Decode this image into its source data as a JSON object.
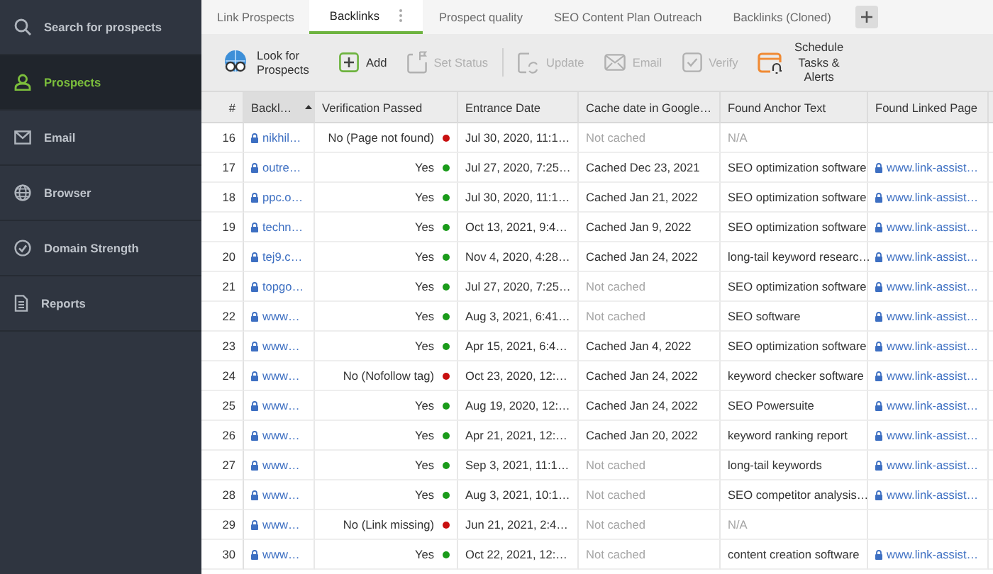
{
  "sidebar": {
    "items": [
      {
        "label": "Search for prospects",
        "selected": false
      },
      {
        "label": "Prospects",
        "selected": true
      },
      {
        "label": "Email",
        "selected": false
      },
      {
        "label": "Browser",
        "selected": false
      },
      {
        "label": "Domain Strength",
        "selected": false
      },
      {
        "label": "Reports",
        "selected": false
      }
    ]
  },
  "tabs": [
    {
      "label": "Link Prospects",
      "selected": false
    },
    {
      "label": "Backlinks",
      "selected": true
    },
    {
      "label": "Prospect quality",
      "selected": false
    },
    {
      "label": "SEO Content Plan Outreach",
      "selected": false
    },
    {
      "label": "Backlinks (Cloned)",
      "selected": false
    }
  ],
  "toolbar": {
    "buttons": [
      {
        "label": "Look for Prospects",
        "disabled": false
      },
      {
        "label": "Add",
        "disabled": false
      },
      {
        "label": "Set Status",
        "disabled": true
      },
      {
        "label": "Update",
        "disabled": true
      },
      {
        "label": "Email",
        "disabled": true
      },
      {
        "label": "Verify",
        "disabled": true
      },
      {
        "label": "Schedule Tasks & Alerts",
        "disabled": false
      }
    ]
  },
  "table": {
    "columns": [
      {
        "label": "#",
        "sorted": false
      },
      {
        "label": "Backl…",
        "sorted": true
      },
      {
        "label": "Verification Passed",
        "sorted": false
      },
      {
        "label": "Entrance Date",
        "sorted": false
      },
      {
        "label": "Cache date in Google…",
        "sorted": false
      },
      {
        "label": "Found Anchor Text",
        "sorted": false
      },
      {
        "label": "Found Linked Page",
        "sorted": false
      }
    ],
    "rows": [
      {
        "num": "16",
        "backlink": "nikhil…",
        "verification": {
          "text": "No (Page not found)",
          "passed": false
        },
        "entrance": "Jul 30, 2020, 11:1…",
        "cache": {
          "text": "Not cached",
          "cached": false
        },
        "anchor": {
          "text": "N/A",
          "found": false
        }
      },
      {
        "num": "17",
        "backlink": "outre…",
        "verification": {
          "text": "Yes",
          "passed": true
        },
        "entrance": "Jul 27, 2020, 7:25…",
        "cache": {
          "text": "Cached Dec 23, 2021",
          "cached": true
        },
        "anchor": {
          "text": "SEO optimization software",
          "found": true
        },
        "linked_page": "www.link-assist…"
      },
      {
        "num": "18",
        "backlink": "ppc.o…",
        "verification": {
          "text": "Yes",
          "passed": true
        },
        "entrance": "Jul 30, 2020, 11:1…",
        "cache": {
          "text": "Cached Jan 21, 2022",
          "cached": true
        },
        "anchor": {
          "text": "SEO optimization software",
          "found": true
        },
        "linked_page": "www.link-assist…"
      },
      {
        "num": "19",
        "backlink": "techn…",
        "verification": {
          "text": "Yes",
          "passed": true
        },
        "entrance": "Oct 13, 2021, 9:4…",
        "cache": {
          "text": "Cached Jan 9, 2022",
          "cached": true
        },
        "anchor": {
          "text": "SEO optimization software",
          "found": true
        },
        "linked_page": "www.link-assist…"
      },
      {
        "num": "20",
        "backlink": "tej9.c…",
        "verification": {
          "text": "Yes",
          "passed": true
        },
        "entrance": "Nov 4, 2020, 4:28…",
        "cache": {
          "text": "Cached Jan 24, 2022",
          "cached": true
        },
        "anchor": {
          "text": "long-tail keyword researc…",
          "found": true
        },
        "linked_page": "www.link-assist…"
      },
      {
        "num": "21",
        "backlink": "topgo…",
        "verification": {
          "text": "Yes",
          "passed": true
        },
        "entrance": "Jul 27, 2020, 7:25…",
        "cache": {
          "text": "Not cached",
          "cached": false
        },
        "anchor": {
          "text": "SEO optimization software",
          "found": true
        },
        "linked_page": "www.link-assist…"
      },
      {
        "num": "22",
        "backlink": "www…",
        "verification": {
          "text": "Yes",
          "passed": true
        },
        "entrance": "Aug 3, 2021, 6:41…",
        "cache": {
          "text": "Not cached",
          "cached": false
        },
        "anchor": {
          "text": "SEO software",
          "found": true
        },
        "linked_page": "www.link-assist…"
      },
      {
        "num": "23",
        "backlink": "www…",
        "verification": {
          "text": "Yes",
          "passed": true
        },
        "entrance": "Apr 15, 2021, 6:4…",
        "cache": {
          "text": "Cached Jan 4, 2022",
          "cached": true
        },
        "anchor": {
          "text": "SEO optimization software",
          "found": true
        },
        "linked_page": "www.link-assist…"
      },
      {
        "num": "24",
        "backlink": "www…",
        "verification": {
          "text": "No (Nofollow tag)",
          "passed": false
        },
        "entrance": "Oct 23, 2020, 12:…",
        "cache": {
          "text": "Cached Jan 24, 2022",
          "cached": true
        },
        "anchor": {
          "text": "keyword checker software",
          "found": true
        },
        "linked_page": "www.link-assist…"
      },
      {
        "num": "25",
        "backlink": "www…",
        "verification": {
          "text": "Yes",
          "passed": true
        },
        "entrance": "Aug 19, 2020, 12:…",
        "cache": {
          "text": "Cached Jan 24, 2022",
          "cached": true
        },
        "anchor": {
          "text": "SEO Powersuite",
          "found": true
        },
        "linked_page": "www.link-assist…"
      },
      {
        "num": "26",
        "backlink": "www…",
        "verification": {
          "text": "Yes",
          "passed": true
        },
        "entrance": "Apr 21, 2021, 12:…",
        "cache": {
          "text": "Cached Jan 20, 2022",
          "cached": true
        },
        "anchor": {
          "text": "keyword ranking report",
          "found": true
        },
        "linked_page": "www.link-assist…"
      },
      {
        "num": "27",
        "backlink": "www…",
        "verification": {
          "text": "Yes",
          "passed": true
        },
        "entrance": "Sep 3, 2021, 11:1…",
        "cache": {
          "text": "Not cached",
          "cached": false
        },
        "anchor": {
          "text": "long-tail keywords",
          "found": true
        },
        "linked_page": "www.link-assist…"
      },
      {
        "num": "28",
        "backlink": "www…",
        "verification": {
          "text": "Yes",
          "passed": true
        },
        "entrance": "Aug 3, 2021, 10:1…",
        "cache": {
          "text": "Not cached",
          "cached": false
        },
        "anchor": {
          "text": "SEO competitor analysis…",
          "found": true
        },
        "linked_page": "www.link-assist…"
      },
      {
        "num": "29",
        "backlink": "www…",
        "verification": {
          "text": "No (Link missing)",
          "passed": false
        },
        "entrance": "Jun 21, 2021, 2:4…",
        "cache": {
          "text": "Not cached",
          "cached": false
        },
        "anchor": {
          "text": "N/A",
          "found": false
        }
      },
      {
        "num": "30",
        "backlink": "www…",
        "verification": {
          "text": "Yes",
          "passed": true
        },
        "entrance": "Oct 22, 2021, 12:…",
        "cache": {
          "text": "Not cached",
          "cached": false
        },
        "anchor": {
          "text": "content creation software",
          "found": true
        },
        "linked_page": "www.link-assist…"
      }
    ]
  }
}
